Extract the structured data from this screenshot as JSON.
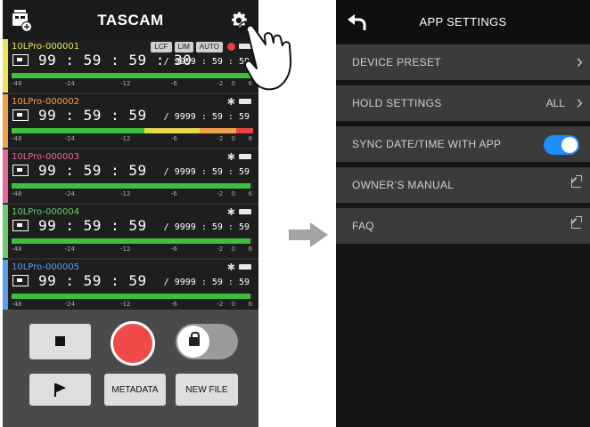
{
  "left_screen": {
    "brand": "TASCAM",
    "recorders": [
      {
        "name": "10LPro-000001",
        "name_color": "#e8e25b",
        "stripe": "#e8e25b",
        "time": "99 : 59 : 59 : 30",
        "remain": "/ 9999 : 59 : 59",
        "badges": [
          "LCF",
          "LIM",
          "AUTO"
        ],
        "show_bt": false,
        "show_dot": true,
        "level": 0.99,
        "level_color": "green"
      },
      {
        "name": "10LPro-000002",
        "name_color": "#f0a24a",
        "stripe": "#f0a24a",
        "time": "99 : 59 : 59",
        "remain": "/ 9999 : 59 : 59",
        "badges": [],
        "show_bt": true,
        "show_dot": false,
        "level": 1.0,
        "level_color": "multi"
      },
      {
        "name": "10LPro-000003",
        "name_color": "#e46a9a",
        "stripe": "#e46a9a",
        "time": "99 : 59 : 59",
        "remain": "/ 9999 : 59 : 59",
        "badges": [],
        "show_bt": true,
        "show_dot": false,
        "level": 0.99,
        "level_color": "green"
      },
      {
        "name": "10LPro-000004",
        "name_color": "#6cc86a",
        "stripe": "#6cc86a",
        "time": "99 : 59 : 59",
        "remain": "/ 9999 : 59 : 59",
        "badges": [],
        "show_bt": true,
        "show_dot": false,
        "level": 0.99,
        "level_color": "green"
      },
      {
        "name": "10LPro-000005",
        "name_color": "#5aa0e8",
        "stripe": "#5aa0e8",
        "time": "99 : 59 : 59",
        "remain": "/ 9999 : 59 : 59",
        "badges": [],
        "show_bt": true,
        "show_dot": false,
        "level": 0.99,
        "level_color": "green"
      }
    ],
    "scale_labels": [
      "-48",
      "-24",
      "-12",
      "-6",
      "-2",
      "0",
      "6"
    ],
    "buttons": {
      "metadata": "METADATA",
      "new_file": "NEW FILE"
    }
  },
  "right_screen": {
    "title": "APP SETTINGS",
    "items": [
      {
        "label": "DEVICE PRESET",
        "value": "",
        "kind": "chevron"
      },
      {
        "label": "HOLD SETTINGS",
        "value": "ALL",
        "kind": "chevron"
      },
      {
        "label": "SYNC DATE/TIME WITH APP",
        "value": "",
        "kind": "toggle",
        "on": true
      },
      {
        "label": "OWNER’S MANUAL",
        "value": "",
        "kind": "external"
      },
      {
        "label": "FAQ",
        "value": "",
        "kind": "external"
      }
    ]
  },
  "colors": {
    "accent_blue": "#1e8fff",
    "record_red": "#f04a4a",
    "meter_green": "#3fbf3f"
  }
}
